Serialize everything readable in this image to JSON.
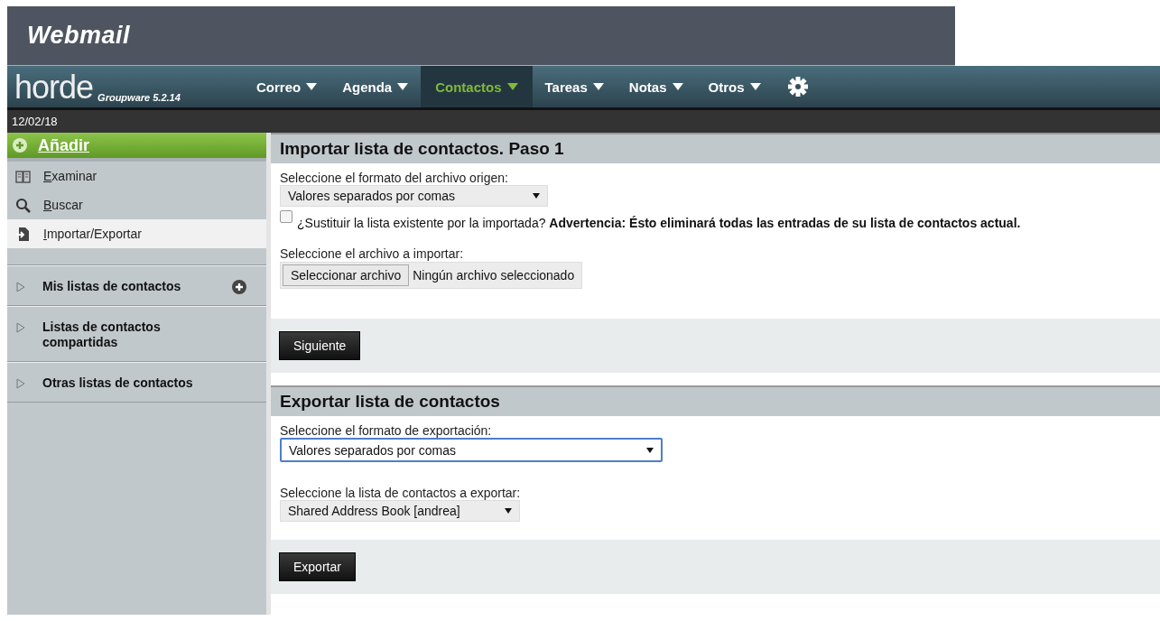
{
  "header": {
    "title": "Webmail"
  },
  "nav": {
    "logo": "horde",
    "version": "Groupware 5.2.14",
    "items": [
      {
        "label": "Correo",
        "selected": false
      },
      {
        "label": "Agenda",
        "selected": false
      },
      {
        "label": "Contactos",
        "selected": true
      },
      {
        "label": "Tareas",
        "selected": false
      },
      {
        "label": "Notas",
        "selected": false
      },
      {
        "label": "Otros",
        "selected": false
      }
    ]
  },
  "date": "12/02/18",
  "sidebar": {
    "add": "Añadir",
    "items": [
      {
        "label": "Examinar",
        "kind": "book",
        "selected": false
      },
      {
        "label": "Buscar",
        "kind": "search",
        "selected": false
      },
      {
        "label": "Importar/Exportar",
        "kind": "import",
        "selected": true
      }
    ],
    "sections": [
      {
        "label": "Mis listas de contactos",
        "expanded": false,
        "add": true
      },
      {
        "label": "Listas de contactos compartidas",
        "expanded": false,
        "add": false
      },
      {
        "label": "Otras listas de contactos",
        "expanded": false,
        "add": false
      }
    ]
  },
  "import": {
    "title": "Importar lista de contactos. Paso 1",
    "format_label": "Seleccione el formato del archivo origen:",
    "format_value": "Valores separados por comas",
    "replace": {
      "checked": false,
      "text": "¿Sustituir la lista existente por la importada? **Advertencia: Ésto eliminará todas las entradas de su lista de contactos actual.**"
    },
    "file_label": "Seleccione el archivo a importar:",
    "file_button": "Seleccionar archivo",
    "file_status": "Ningún archivo seleccionado",
    "submit": "Siguiente"
  },
  "export": {
    "title": "Exportar lista de contactos",
    "format_label": "Seleccione el formato de exportación:",
    "format_value": "Valores separados por comas",
    "list_label": "Seleccione la lista de contactos a exportar:",
    "list_value": "Shared Address Book [andrea]",
    "submit": "Exportar"
  }
}
